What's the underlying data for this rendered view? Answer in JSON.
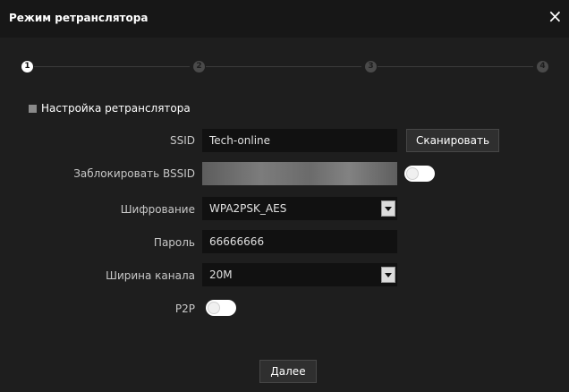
{
  "dialog": {
    "title": "Режим ретранслятора",
    "close_icon": "×"
  },
  "stepper": {
    "steps": [
      "1",
      "2",
      "3",
      "4"
    ],
    "active_step": 1
  },
  "section": {
    "title": "Настройка ретранслятора"
  },
  "form": {
    "ssid": {
      "label": "SSID",
      "value": "Tech-online"
    },
    "scan_button": "Сканировать",
    "lock_bssid": {
      "label": "Заблокировать BSSID",
      "toggle_on": false
    },
    "encryption": {
      "label": "Шифрование",
      "value": "WPA2PSK_AES"
    },
    "password": {
      "label": "Пароль",
      "value": "66666666"
    },
    "channel_width": {
      "label": "Ширина канала",
      "value": "20M"
    },
    "p2p": {
      "label": "P2P",
      "toggle_on": false
    }
  },
  "next_button": "Далее"
}
